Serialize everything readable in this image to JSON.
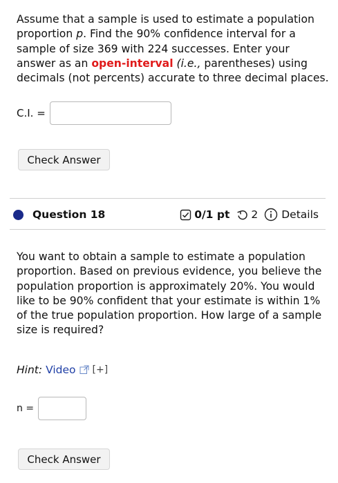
{
  "q17": {
    "text_a": "Assume that a sample is used to estimate a population proportion ",
    "var_p": "p",
    "text_b": ". Find the 90% confidence interval for a sample of size 369 with 224 successes. Enter your answer as an ",
    "highlight": "open-interval",
    "ie": "(i.e.,",
    "text_c": " parentheses) using decimals (not percents) accurate to three decimal places.",
    "ci_label": "C.I. =",
    "ci_value": "",
    "check_label": "Check Answer"
  },
  "q18": {
    "title": "Question 18",
    "points": "0/1 pt",
    "tries": "2",
    "details_label": "Details",
    "text": "You want to obtain a sample to estimate a population proportion. Based on previous evidence, you believe the population proportion is approximately 20%. You would like to be 90% confident that your estimate is within 1% of the true population proportion. How large of a sample size is required?",
    "hint_label": "Hint:",
    "hint_link": "Video",
    "expand": "[+]",
    "n_label": "n =",
    "n_value": "",
    "check_label": "Check Answer"
  },
  "colors": {
    "accent_red": "#e01b1b",
    "link_blue": "#1f3fa6",
    "question_dot": "#1a2a8a"
  },
  "icons": [
    "checkbox-icon",
    "retry-icon",
    "info-icon",
    "external-link-icon"
  ]
}
